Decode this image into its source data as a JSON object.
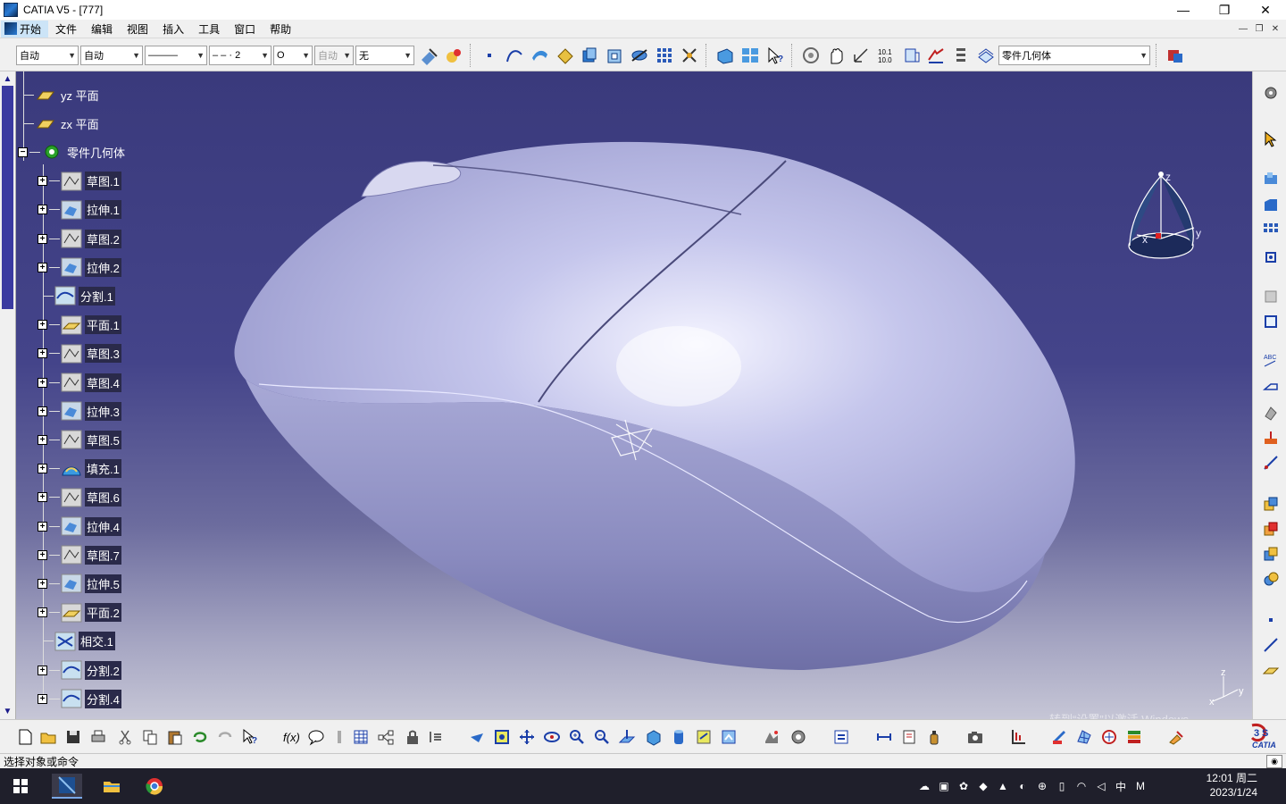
{
  "window": {
    "title": "CATIA V5 - [777]",
    "minimize": "—",
    "maximize": "❐",
    "close": "✕"
  },
  "menu": {
    "items": [
      {
        "label": "开始"
      },
      {
        "label": "文件"
      },
      {
        "label": "编辑"
      },
      {
        "label": "视图"
      },
      {
        "label": "插入"
      },
      {
        "label": "工具"
      },
      {
        "label": "窗口"
      },
      {
        "label": "帮助"
      }
    ],
    "mdi_minimize": "—",
    "mdi_restore": "❐",
    "mdi_close": "✕"
  },
  "toolbar_top": {
    "color_combo": "自动",
    "linewidth_combo": "自动",
    "linetype_combo": "———",
    "dashed_combo": "– – · 2",
    "point_combo": "O",
    "layer_combo": "自动",
    "filter_combo": "无",
    "current_body_combo": "零件几何体"
  },
  "tree": {
    "items": [
      {
        "label": "yz 平面",
        "type": "plane",
        "expandable": false
      },
      {
        "label": "zx 平面",
        "type": "plane",
        "expandable": false
      },
      {
        "label": "零件几何体",
        "type": "body",
        "expandable": true
      },
      {
        "label": "草图.1",
        "type": "sketch",
        "expandable": true
      },
      {
        "label": "拉伸.1",
        "type": "extrude",
        "expandable": true
      },
      {
        "label": "草图.2",
        "type": "sketch",
        "expandable": true
      },
      {
        "label": "拉伸.2",
        "type": "extrude",
        "expandable": true
      },
      {
        "label": "分割.1",
        "type": "split",
        "expandable": false
      },
      {
        "label": "平面.1",
        "type": "plane-feature",
        "expandable": true
      },
      {
        "label": "草图.3",
        "type": "sketch",
        "expandable": true
      },
      {
        "label": "草图.4",
        "type": "sketch",
        "expandable": true
      },
      {
        "label": "拉伸.3",
        "type": "extrude",
        "expandable": true
      },
      {
        "label": "草图.5",
        "type": "sketch",
        "expandable": true
      },
      {
        "label": "填充.1",
        "type": "fill",
        "expandable": true
      },
      {
        "label": "草图.6",
        "type": "sketch",
        "expandable": true
      },
      {
        "label": "拉伸.4",
        "type": "extrude",
        "expandable": true
      },
      {
        "label": "草图.7",
        "type": "sketch",
        "expandable": true
      },
      {
        "label": "拉伸.5",
        "type": "extrude",
        "expandable": true
      },
      {
        "label": "平面.2",
        "type": "plane-feature",
        "expandable": true
      },
      {
        "label": "相交.1",
        "type": "intersect",
        "expandable": false
      },
      {
        "label": "分割.2",
        "type": "split",
        "expandable": true
      },
      {
        "label": "分割.4",
        "type": "split",
        "expandable": true
      }
    ]
  },
  "compass": {
    "x": "x",
    "y": "y",
    "z": "z"
  },
  "axis_indicator": {
    "x": "x",
    "y": "y",
    "z": "z"
  },
  "watermark": "转到“设置”以激活 Windows。",
  "status": {
    "prompt": "选择对象或命令"
  },
  "taskbar": {
    "clock_time": "12:01 周二",
    "clock_date": "2023/1/24",
    "ime": "中",
    "ime_mode": "M"
  },
  "colors": {
    "viewport_top": "#3a3a7c",
    "viewport_bottom": "#c6c6d6",
    "model": "#b9bae0",
    "selection": "#2a2a4a"
  }
}
